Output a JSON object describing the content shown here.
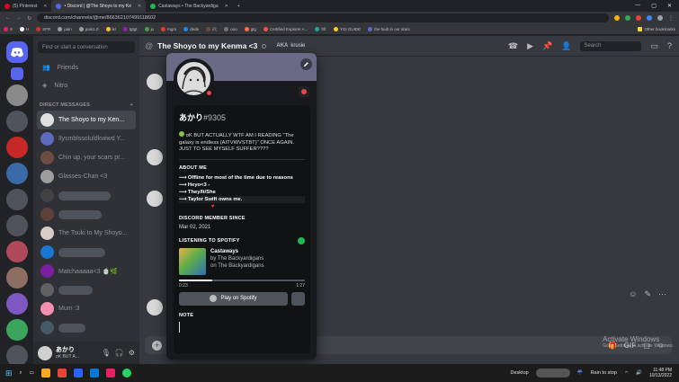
{
  "browser": {
    "tabs": [
      {
        "label": "(5) Pinterest",
        "color": "#e60023"
      },
      {
        "label": "• Discord | @The Shoyo to my Ke",
        "color": "#5865f2"
      },
      {
        "label": "Castaways • The Backyardiga",
        "color": "#1db954"
      }
    ],
    "url": "discord.com/channels/@me/866362107499118602",
    "bookmarks": [
      "S",
      "H",
      "SFR",
      "pain",
      "pain1.0",
      "ikl",
      "tgtgt",
      "ju",
      "mgm",
      "dede",
      "///;",
      "ooo",
      "gtg",
      "Certified Explorer A...",
      "frfr",
      "YGI GUIDE",
      "the fault in our stars"
    ],
    "other_bookmarks": "Other bookmarks"
  },
  "sidebar": {
    "search_placeholder": "Find or start a conversation",
    "nav": [
      {
        "label": "Friends",
        "icon": "friends-icon"
      },
      {
        "label": "Nitro",
        "icon": "nitro-icon"
      }
    ],
    "dm_header": "DIRECT MESSAGES",
    "dm_add": "+",
    "dms": [
      {
        "label": "The Shoyo to my Ken...",
        "selected": true
      },
      {
        "label": "Ilysmblssoluldkwiwd Y..."
      },
      {
        "label": "Chin up, your scars pr..."
      },
      {
        "label": "Glasses-Chan <3"
      },
      {
        "label": ""
      },
      {
        "label": ""
      },
      {
        "label": "The Tsuki to My Shoyo..."
      },
      {
        "label": ""
      },
      {
        "label": "Matchaaaaa<3 🍵🌿"
      },
      {
        "label": ""
      },
      {
        "label": "Mum :3"
      },
      {
        "label": ""
      }
    ]
  },
  "user_panel": {
    "name": "あかり",
    "status": "oK BUT A...",
    "icons": [
      "microphone-icon",
      "headphones-icon",
      "settings-icon"
    ]
  },
  "chat": {
    "title": "The Shoyo to my Kenma <3",
    "aka_label": "AKA",
    "aka_name": "krusie",
    "search_placeholder": "Search"
  },
  "profile": {
    "username": "あかり",
    "discriminator": "#9305",
    "custom_status": "oK BUT ACTUALLY WTF AM I READING \"The galaxy is endless (AITVWVSTBT)\" ONCE AGAIN. JUST TO SEE MYSELF SUFFER????",
    "about_title": "ABOUT ME",
    "about_lines": [
      "⟶ Offline for most of the time due to reasons",
      "⟶ Heyo<3 -",
      "⟶ They/It/She",
      "⟶ Taylor Swift owns me."
    ],
    "member_since_title": "DISCORD MEMBER SINCE",
    "member_since": "Mar 02, 2021",
    "spotify_title": "LISTENING TO SPOTIFY",
    "track": "Castaways",
    "by": "by The Backyardigans",
    "on": "on The Backyardigans",
    "elapsed": "0:23",
    "duration": "1:27",
    "progress": 0.264,
    "play_label": "Play on Spotify",
    "note_title": "NOTE"
  },
  "watermark": {
    "line1": "Activate Windows",
    "line2": "Go to Settings to activate Windows."
  },
  "taskbar": {
    "desktop": "Desktop",
    "weather": "Rain to stop",
    "time": "11:48 PM",
    "date": "10/13/2022"
  },
  "colors": {
    "blurple": "#5865f2",
    "spotify": "#1db954",
    "dnd": "#ed4245"
  }
}
